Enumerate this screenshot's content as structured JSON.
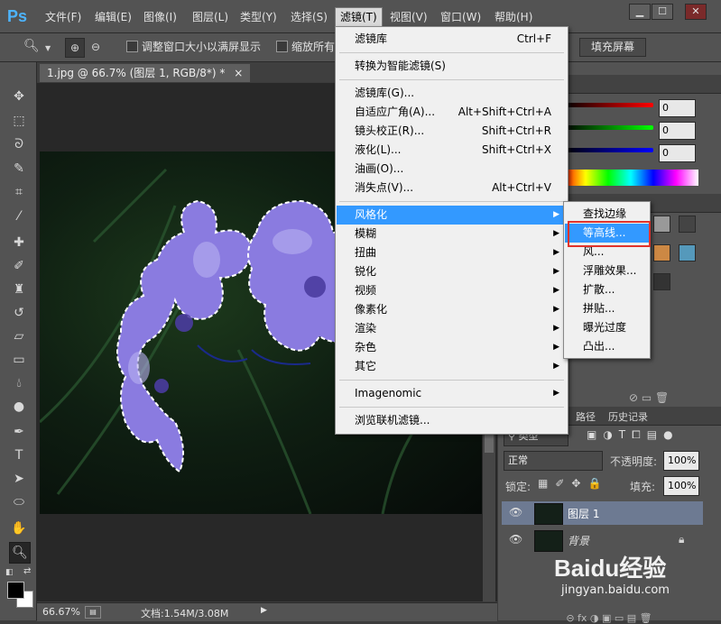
{
  "app": {
    "logo": "Ps"
  },
  "menubar": {
    "items": [
      "文件(F)",
      "编辑(E)",
      "图像(I)",
      "图层(L)",
      "类型(Y)",
      "选择(S)",
      "滤镜(T)",
      "视图(V)",
      "窗口(W)",
      "帮助(H)"
    ],
    "active_label": "滤镜(T)",
    "win_minimize": "▁",
    "win_restore": "☐",
    "win_close": "✕"
  },
  "options": {
    "resize_windows_label": "调整窗口大小以满屏显示",
    "zoom_all_label": "缩放所有",
    "fill_screen_label": "填充屏幕"
  },
  "document": {
    "tab_title": "1.jpg @ 66.7% (图层 1, RGB/8*) *",
    "tab_close": "×",
    "zoom": "66.67%",
    "doc_info": "文档:1.54M/3.08M"
  },
  "filter_menu": {
    "items": [
      {
        "label": "滤镜库",
        "shortcut": "Ctrl+F"
      },
      {
        "label": "转换为智能滤镜(S)",
        "shortcut": ""
      },
      {
        "label": "滤镜库(G)...",
        "shortcut": ""
      },
      {
        "label": "自适应广角(A)...",
        "shortcut": "Alt+Shift+Ctrl+A"
      },
      {
        "label": "镜头校正(R)...",
        "shortcut": "Shift+Ctrl+R"
      },
      {
        "label": "液化(L)...",
        "shortcut": "Shift+Ctrl+X"
      },
      {
        "label": "油画(O)...",
        "shortcut": ""
      },
      {
        "label": "消失点(V)...",
        "shortcut": "Alt+Ctrl+V"
      },
      {
        "label": "风格化",
        "shortcut": ""
      },
      {
        "label": "模糊",
        "shortcut": ""
      },
      {
        "label": "扭曲",
        "shortcut": ""
      },
      {
        "label": "锐化",
        "shortcut": ""
      },
      {
        "label": "视频",
        "shortcut": ""
      },
      {
        "label": "像素化",
        "shortcut": ""
      },
      {
        "label": "渲染",
        "shortcut": ""
      },
      {
        "label": "杂色",
        "shortcut": ""
      },
      {
        "label": "其它",
        "shortcut": ""
      },
      {
        "label": "Imagenomic",
        "shortcut": ""
      },
      {
        "label": "浏览联机滤镜...",
        "shortcut": ""
      }
    ]
  },
  "stylize_submenu": {
    "items": [
      "查找边缘",
      "等高线...",
      "风...",
      "浮雕效果...",
      "扩散...",
      "拼贴...",
      "曝光过度",
      "凸出..."
    ]
  },
  "color_panel": {
    "values": [
      "0",
      "0",
      "0"
    ]
  },
  "layers_panel": {
    "tabs": [
      "路径",
      "历史记录"
    ],
    "kind_filter": "类型",
    "blend_mode": "正常",
    "opacity_label": "不透明度:",
    "opacity_value": "100%",
    "lock_label": "锁定:",
    "fill_label": "填充:",
    "fill_value": "100%",
    "layers": [
      {
        "name": "图层 1",
        "selected": true
      },
      {
        "name": "背景",
        "selected": false
      }
    ],
    "footer_icons": "⊝  fx  ◑  ▣  ▭  ▤  🗑"
  },
  "watermark": {
    "text": "Baidu经验",
    "url": "jingyan.baidu.com"
  },
  "colors": {
    "highlight": "#3399ff",
    "contour_box": "#e0332c",
    "flower": "#8a7be0"
  }
}
